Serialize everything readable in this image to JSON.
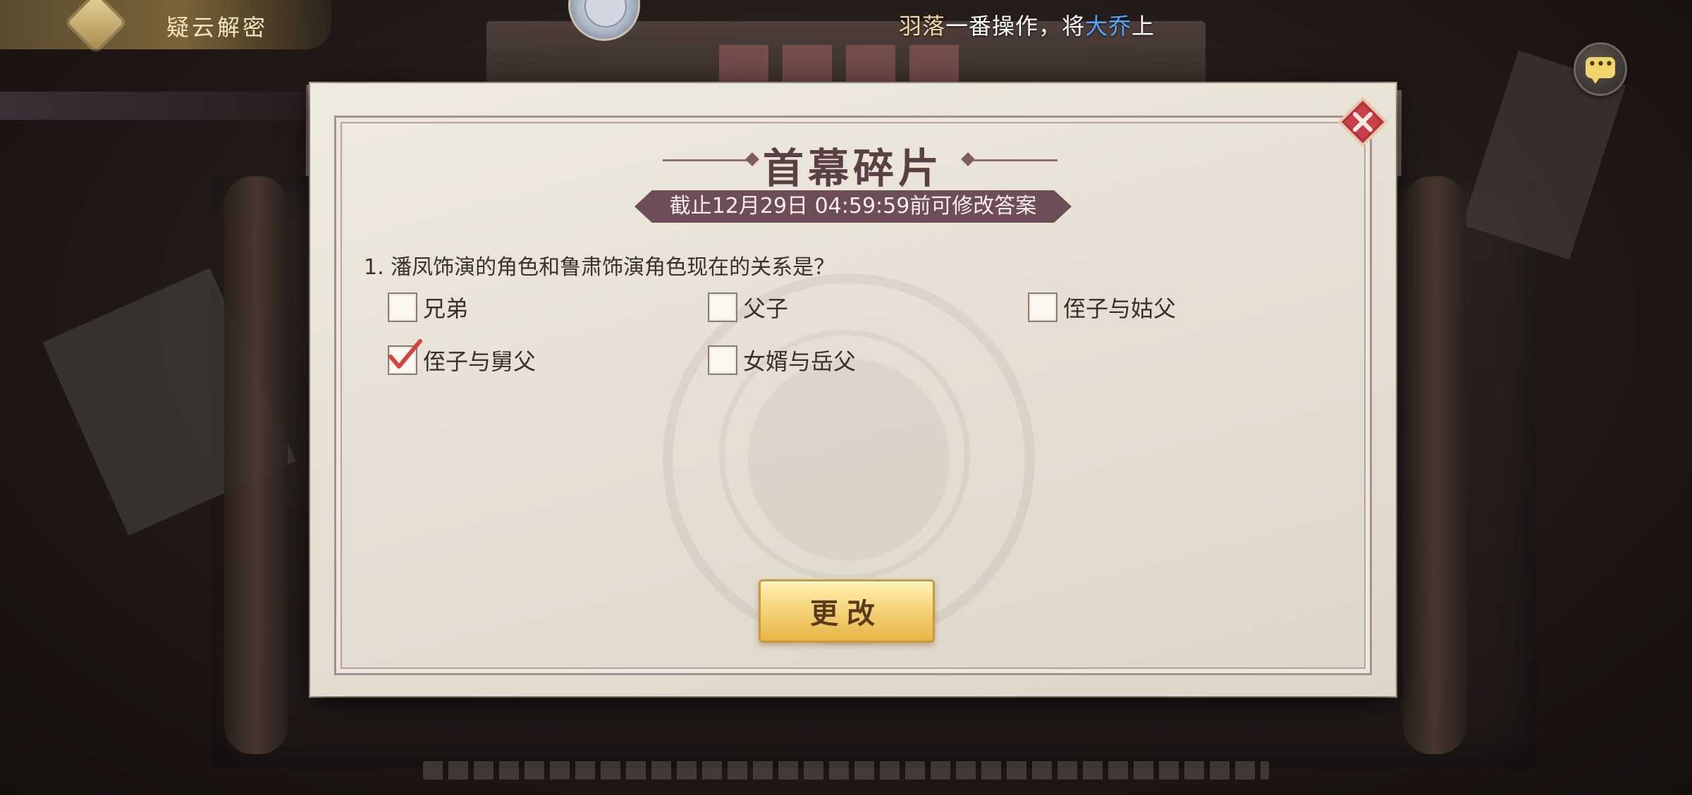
{
  "background": {
    "top_tab_label": "疑云解密"
  },
  "marquee": {
    "name": "羽落",
    "middle": "一番操作，将",
    "highlight": "大乔",
    "tail": "上"
  },
  "modal": {
    "title": "首幕碎片",
    "deadline": "截止12月29日 04:59:59前可修改答案",
    "question": "1. 潘凤饰演的角色和鲁肃饰演角色现在的关系是？",
    "options": [
      {
        "label": "兄弟",
        "checked": false
      },
      {
        "label": "父子",
        "checked": false
      },
      {
        "label": "侄子与姑父",
        "checked": false
      },
      {
        "label": "侄子与舅父",
        "checked": true
      },
      {
        "label": "女婿与岳父",
        "checked": false
      }
    ],
    "change_button": "更改"
  },
  "colors": {
    "title": "#5a3f45",
    "deadline_bg": "#6e4e56",
    "button_gold": "#f6d57c",
    "check_red": "#d2443c",
    "marquee_highlight": "#55a6ff",
    "marquee_name": "#f6d8a8"
  },
  "icons": {
    "close": "close-icon",
    "chat": "chat-icon",
    "checkmark": "checkmark-icon"
  }
}
